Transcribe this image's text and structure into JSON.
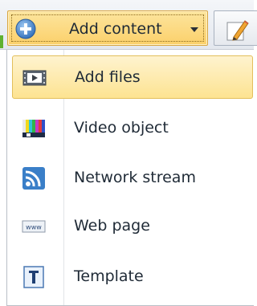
{
  "toolbar": {
    "add_content_label": "Add content",
    "add_icon": "plus-circle-icon",
    "dropdown_icon": "caret-down-icon",
    "edit_icon": "pencil-icon"
  },
  "menu": {
    "items": [
      {
        "label": "Add files",
        "icon": "film-icon",
        "highlighted": true
      },
      {
        "label": "Video object",
        "icon": "color-bars-icon",
        "highlighted": false
      },
      {
        "label": "Network stream",
        "icon": "rss-icon",
        "highlighted": false
      },
      {
        "label": "Web page",
        "icon": "www-icon",
        "highlighted": false
      },
      {
        "label": "Template",
        "icon": "template-t-icon",
        "highlighted": false
      }
    ]
  },
  "colors": {
    "button_active": "#fbd06a",
    "highlight_bg": "#fde391",
    "highlight_border": "#e3bf5b",
    "rss_blue": "#3a7fc8",
    "accent_green": "#5fb130"
  }
}
